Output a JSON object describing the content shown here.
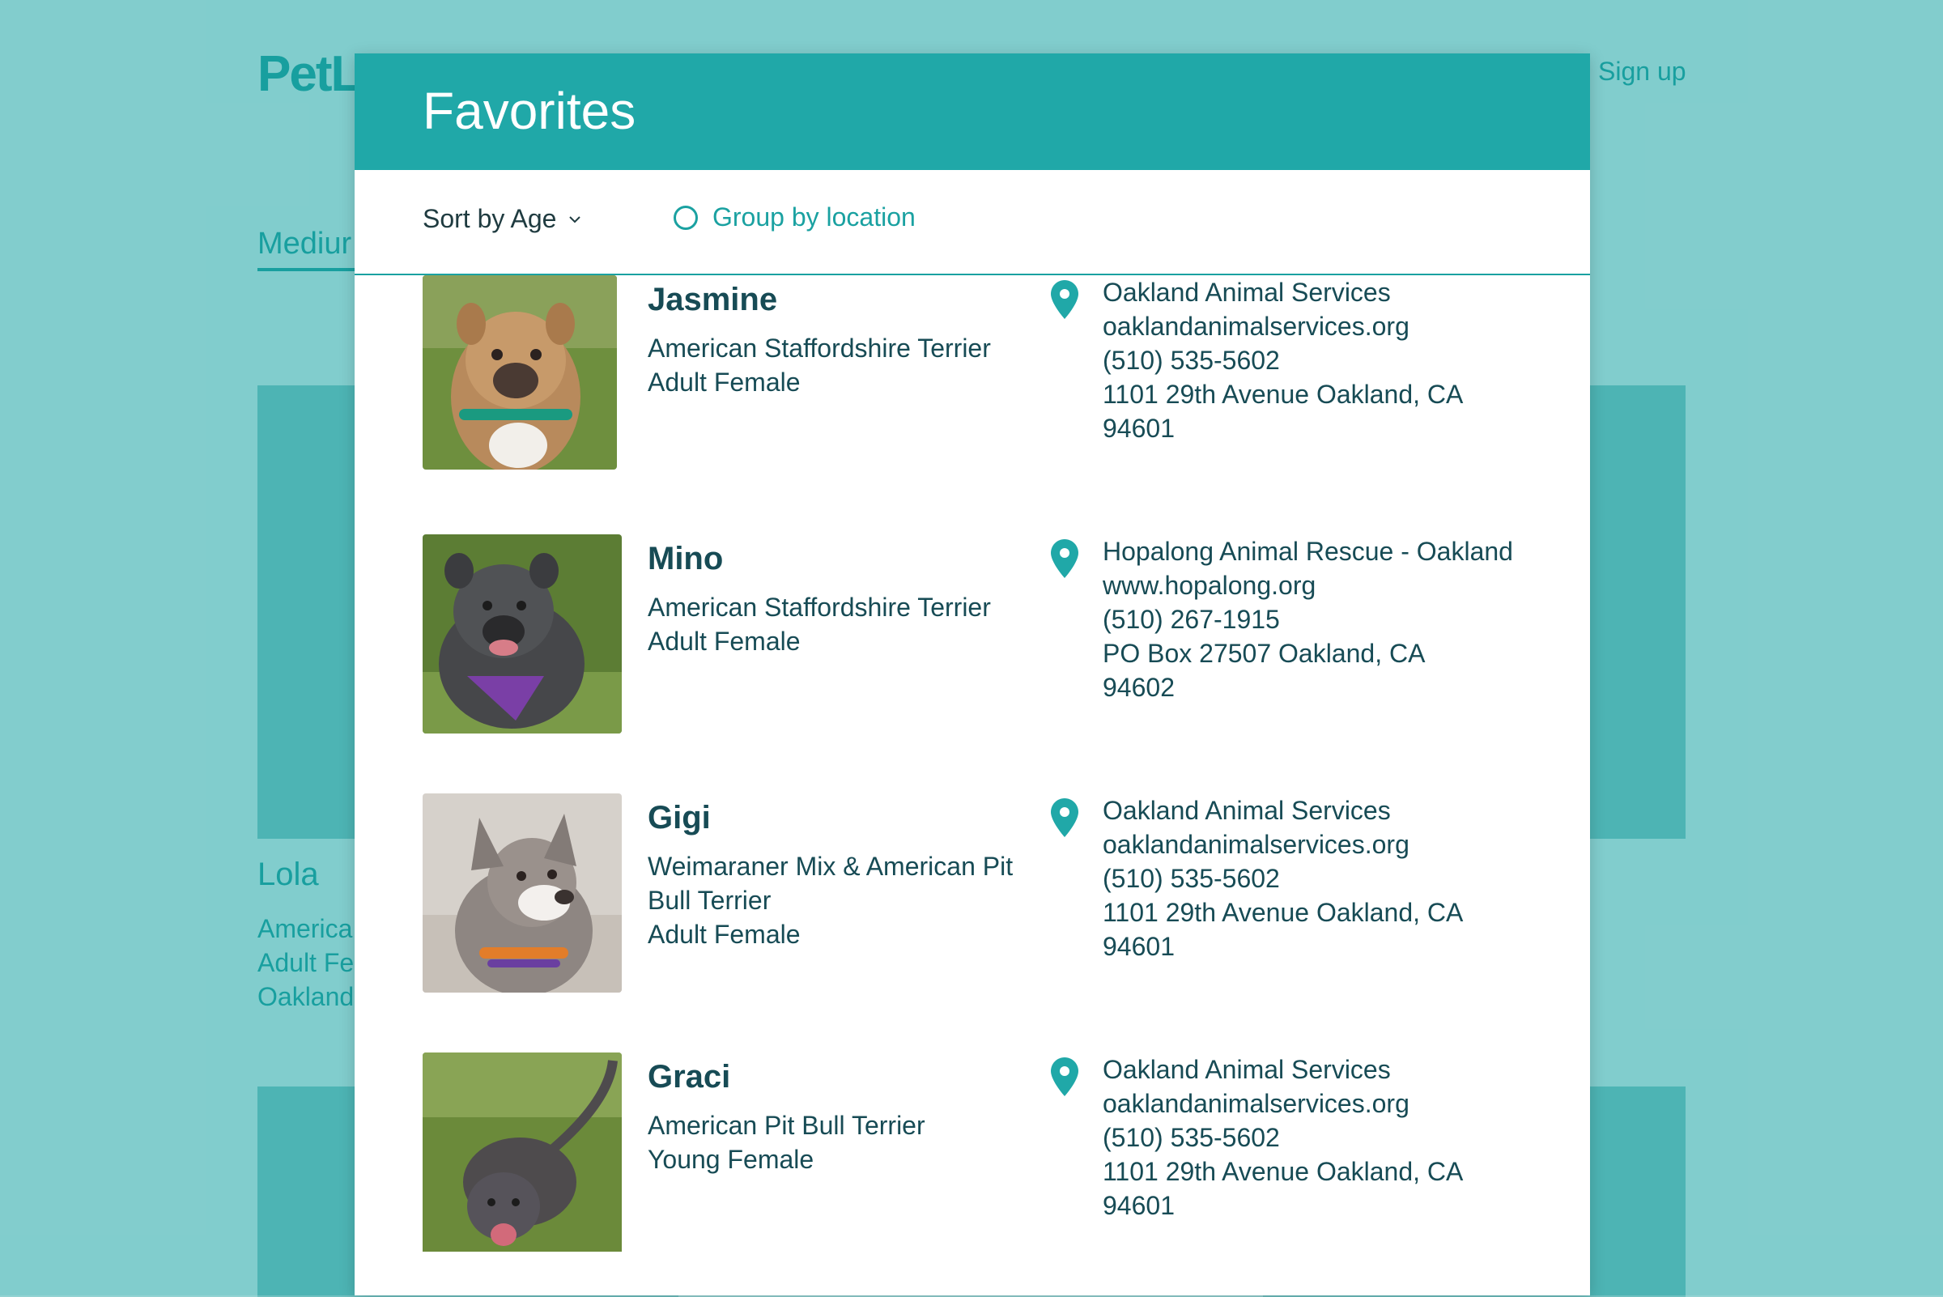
{
  "background": {
    "logo_text": "PetL",
    "signup_label": "Sign up",
    "tab_label": "Mediur",
    "pet_name": "Lola",
    "pet_lines": [
      "America",
      "Adult Fe",
      "Oakland,"
    ]
  },
  "modal": {
    "title": "Favorites",
    "sort_label": "Sort by Age",
    "group_label": "Group by location"
  },
  "favorites": [
    {
      "name": "Jasmine",
      "breed": "American Staffordshire Terrier",
      "age_gender": "Adult Female",
      "org": {
        "name": "Oakland Animal Services",
        "website": "oaklandanimalservices.org",
        "phone": "(510) 535-5602",
        "address": "1101 29th Avenue Oakland, CA",
        "zip": "94601"
      }
    },
    {
      "name": "Mino",
      "breed": "American Staffordshire Terrier",
      "age_gender": "Adult Female",
      "org": {
        "name": "Hopalong Animal Rescue - Oakland",
        "website": "www.hopalong.org",
        "phone": "(510) 267-1915",
        "address": "PO Box 27507 Oakland, CA",
        "zip": "94602"
      }
    },
    {
      "name": "Gigi",
      "breed": "Weimaraner Mix & American Pit Bull Terrier",
      "age_gender": "Adult Female",
      "org": {
        "name": "Oakland Animal Services",
        "website": "oaklandanimalservices.org",
        "phone": "(510) 535-5602",
        "address": "1101 29th Avenue Oakland, CA",
        "zip": "94601"
      }
    },
    {
      "name": "Graci",
      "breed": "American Pit Bull Terrier",
      "age_gender": "Young Female",
      "org": {
        "name": "Oakland Animal Services",
        "website": "oaklandanimalservices.org",
        "phone": "(510) 535-5602",
        "address": "1101 29th Avenue Oakland, CA",
        "zip": "94601"
      }
    }
  ],
  "colors": {
    "accent": "#20a8a8",
    "text": "#174b55",
    "overlay": "#93d3d3"
  }
}
